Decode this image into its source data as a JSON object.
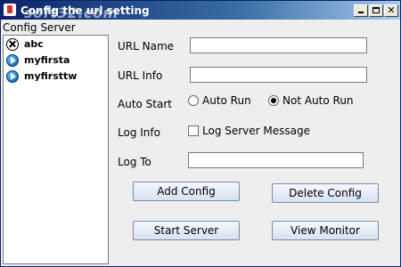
{
  "window": {
    "title": "Config the url setting",
    "watermark": "soft32.com"
  },
  "sidebar": {
    "title": "Config Server",
    "items": [
      {
        "label": "abc",
        "status": "stopped",
        "icon": "stopped-server-icon"
      },
      {
        "label": "myfirsta",
        "status": "running",
        "icon": "running-server-icon"
      },
      {
        "label": "myfirsttw",
        "status": "running",
        "icon": "running-server-icon"
      }
    ]
  },
  "form": {
    "url_name": {
      "label": "URL Name",
      "value": ""
    },
    "url_info": {
      "label": "URL Info",
      "value": ""
    },
    "auto_start": {
      "label": "Auto Start",
      "options": [
        {
          "label": "Auto Run",
          "selected": false
        },
        {
          "label": "Not Auto Run",
          "selected": true
        }
      ]
    },
    "log_info": {
      "label": "Log Info",
      "checkbox_label": "Log Server Message",
      "checked": false
    },
    "log_to": {
      "label": "Log To",
      "value": ""
    }
  },
  "buttons": {
    "add_config": "Add Config",
    "delete_config": "Delete Config",
    "start_server": "Start Server",
    "view_monitor": "View Monitor"
  },
  "colors": {
    "titlebar_start": "#0a246a",
    "titlebar_end": "#a6caf0",
    "window_bg": "#eeeeee"
  }
}
